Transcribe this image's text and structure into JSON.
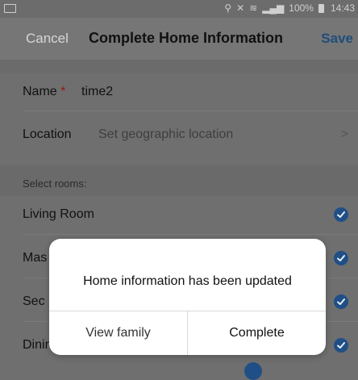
{
  "status_bar": {
    "battery": "100%",
    "time": "14:43",
    "icons": [
      "image-icon",
      "location-icon",
      "mute-icon",
      "wifi-icon",
      "signal-icon",
      "battery-icon"
    ]
  },
  "nav": {
    "cancel": "Cancel",
    "title": "Complete Home Information",
    "save": "Save"
  },
  "form": {
    "name_label": "Name",
    "required_mark": "*",
    "name_value": "time2",
    "location_label": "Location",
    "location_placeholder": "Set geographic location",
    "chevron": ">"
  },
  "rooms": {
    "section_label": "Select rooms:",
    "items": [
      {
        "label": "Living Room",
        "checked": true
      },
      {
        "label": "Mas",
        "checked": true
      },
      {
        "label": "Sec",
        "checked": true
      },
      {
        "label": "Dinir",
        "checked": true
      }
    ]
  },
  "dialog": {
    "message": "Home information has been updated",
    "left_button": "View family",
    "right_button": "Complete"
  },
  "colors": {
    "accent": "#1f4f86",
    "required": "#8e1f0f",
    "overlay_background": "#6f6f6f",
    "dialog_background": "#ffffff"
  }
}
